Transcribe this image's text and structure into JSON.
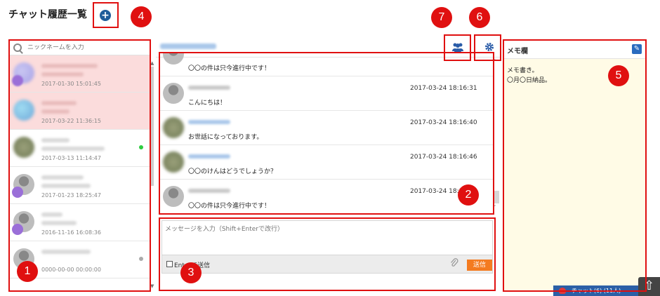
{
  "header": {
    "title": "チャット履歴一覧",
    "add_icon": "plus-circle-icon"
  },
  "search": {
    "placeholder": "ニックネームを入力",
    "icon": "search-icon"
  },
  "contacts": [
    {
      "date": "2017-01-30 15:01:45",
      "highlighted": true
    },
    {
      "date": "2017-03-22 11:36:15",
      "highlighted": true
    },
    {
      "date": "2017-03-13 11:14:47",
      "highlighted": false,
      "status_color": "#2ecc40"
    },
    {
      "date": "2017-01-23 18:25:47",
      "highlighted": false
    },
    {
      "date": "2016-11-16 16:08:36",
      "highlighted": false
    },
    {
      "date": "0000-00-00 00:00:00",
      "highlighted": false,
      "status_color": "#aaaaaa"
    }
  ],
  "chat": {
    "messages": [
      {
        "time": "",
        "text": "〇〇の件は只今進行中です！"
      },
      {
        "time": "2017-03-24 18:16:31",
        "text": "こんにちは！"
      },
      {
        "time": "2017-03-24 18:16:40",
        "text": "お世話になっております。"
      },
      {
        "time": "2017-03-24 18:16:46",
        "text": "〇〇のけんはどうでしょうか？"
      },
      {
        "time": "2017-03-24 18:16:56",
        "text": "〇〇の件は只今進行中です！"
      }
    ]
  },
  "composer": {
    "placeholder": "メッセージを入力（Shift+Enterで改行）",
    "enter_label": "Enterで送信",
    "send_label": "送信"
  },
  "memo": {
    "title": "メモ欄",
    "lines": [
      "メモ書き。",
      "〇月〇日納品。"
    ]
  },
  "footer": {
    "chat_button": "チャット(6) (11人)"
  },
  "annotations": {
    "n1": "1",
    "n2": "2",
    "n3": "3",
    "n4": "4",
    "n5": "5",
    "n6": "6",
    "n7": "7"
  },
  "colors": {
    "accent": "#2a5ca8",
    "highlight": "#e01010",
    "send": "#f47b20",
    "memo_bg": "#fffbe6",
    "unread_bg": "#fbdcdc"
  }
}
